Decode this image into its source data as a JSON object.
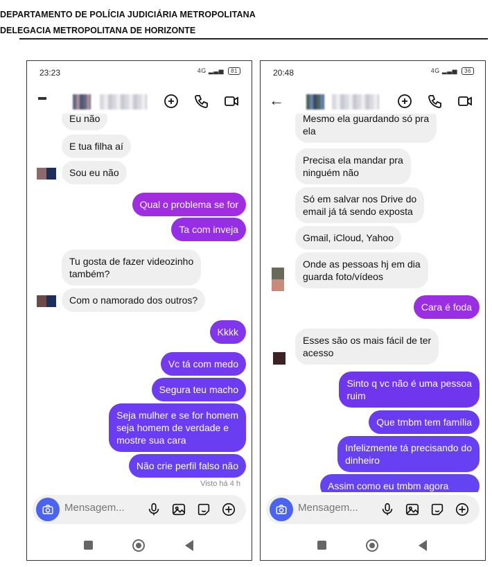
{
  "document": {
    "line1": "DEPARTAMENTO DE POLÍCIA JUDICIÁRIA METROPOLITANA",
    "line2": "DELEGACIA METROPOLITANA DE HORIZONTE"
  },
  "left_phone": {
    "status": {
      "time": "23:23",
      "network": "4G",
      "battery": "81"
    },
    "messages": [
      {
        "side": "in",
        "text": "Eu não"
      },
      {
        "side": "in",
        "text": "E tua filha aí"
      },
      {
        "side": "in",
        "text": "Sou eu não"
      },
      {
        "side": "out",
        "text": "Qual o problema se for"
      },
      {
        "side": "out",
        "text": "Ta com inveja"
      },
      {
        "side": "in",
        "text": "Tu gosta de fazer videozinho\ntambém?"
      },
      {
        "side": "in",
        "text": "Com o namorado dos outros?"
      },
      {
        "side": "out",
        "text": "Kkkk"
      },
      {
        "side": "out",
        "text": "Vc tá com medo"
      },
      {
        "side": "out",
        "text": "Segura teu macho"
      },
      {
        "side": "out",
        "text": "Seja mulher e se for homem\nseja homem de verdade e\nmostre sua cara"
      },
      {
        "side": "out",
        "text": "Não crie perfil falso não"
      }
    ],
    "seen": "Visto há 4 h",
    "composer_placeholder": "Mensagem..."
  },
  "right_phone": {
    "status": {
      "time": "20:48",
      "network": "4G",
      "battery": "36"
    },
    "messages": [
      {
        "side": "in",
        "text": "Mesmo ela guardando só pra\nela"
      },
      {
        "side": "in",
        "text": "Precisa ela mandar pra\nninguém não"
      },
      {
        "side": "in",
        "text": "Só em salvar nos Drive do\nemail já tá sendo exposta"
      },
      {
        "side": "in",
        "text": "Gmail, iCloud, Yahoo"
      },
      {
        "side": "in",
        "text": "Onde as pessoas hj em dia\nguarda foto/vídeos"
      },
      {
        "side": "out",
        "text": "Cara é foda"
      },
      {
        "side": "in",
        "text": "Esses são os mais fácil de ter\nacesso"
      },
      {
        "side": "out",
        "text": "Sinto q vc não é uma pessoa\nruim"
      },
      {
        "side": "out",
        "text": "Que tmbm tem família"
      },
      {
        "side": "out",
        "text": "Infelizmente tá precisando do\ndinheiro"
      },
      {
        "side": "out",
        "text": "Assim como eu tmbm agora"
      }
    ],
    "composer_placeholder": "Mensagem..."
  },
  "colors": {
    "incoming_bubble": "#efefef",
    "outgoing_purple": "#9a2ee0",
    "outgoing_violet": "#6a3cf0",
    "camera_button": "#4a63f0"
  }
}
